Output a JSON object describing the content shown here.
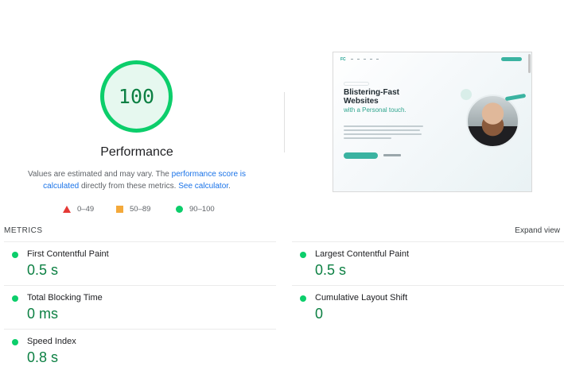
{
  "score": {
    "value": "100",
    "fraction": 1.0,
    "color": "#0cce6b",
    "text_color": "#0c8043"
  },
  "category": {
    "title": "Performance",
    "description_prefix": "Values are estimated and may vary. The ",
    "description_link1": "performance score is calculated",
    "description_middle": " directly from these metrics. ",
    "description_link2": "See calculator",
    "description_suffix": "."
  },
  "legend": {
    "items": [
      {
        "label": "0–49",
        "icon": "triangle-icon",
        "color": "#e53935"
      },
      {
        "label": "50–89",
        "icon": "square-icon",
        "color": "#f4a93a"
      },
      {
        "label": "90–100",
        "icon": "circle-icon",
        "color": "#0cce6b"
      }
    ]
  },
  "screenshot": {
    "headline_line1": "Blistering-Fast",
    "headline_line2": "Websites",
    "headline_line3": "with a Personal touch."
  },
  "metrics": {
    "label": "METRICS",
    "expand": "Expand view",
    "items": [
      {
        "name": "First Contentful Paint",
        "value": "0.5 s"
      },
      {
        "name": "Largest Contentful Paint",
        "value": "0.5 s"
      },
      {
        "name": "Total Blocking Time",
        "value": "0 ms"
      },
      {
        "name": "Cumulative Layout Shift",
        "value": "0"
      },
      {
        "name": "Speed Index",
        "value": "0.8 s"
      }
    ]
  }
}
